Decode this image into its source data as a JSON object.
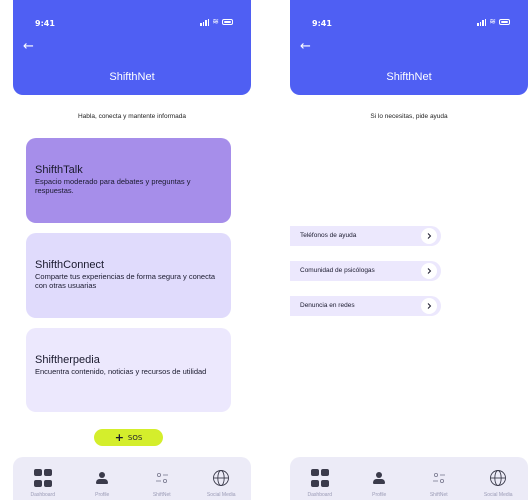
{
  "status_bar": {
    "time": "9:41"
  },
  "left_screen": {
    "header": {
      "back_arrow": "←",
      "title": "ShifthNet"
    },
    "subtitle": "Habla, conecta y mantente informada",
    "cards": [
      {
        "title": "ShifthTalk",
        "description": "Espacio moderado para debates y preguntas y respuestas.",
        "color": "#a68eea"
      },
      {
        "title": "ShifthConnect",
        "description": "Comparte tus experiencias de forma segura y conecta con otras usuarias",
        "color": "#e0dbfc"
      },
      {
        "title": "Shiftherpedia",
        "description": "Encuentra contenido, noticias y recursos de utilidad",
        "color": "#ece8fd"
      }
    ],
    "sos_button": {
      "label": "SOS",
      "icon": "plus-icon",
      "color": "#d4ee2c"
    }
  },
  "right_screen": {
    "header": {
      "back_arrow": "←",
      "title": "ShifthNet"
    },
    "subtitle": "Si lo necesitas, pide ayuda",
    "help_items": [
      {
        "label": "Teléfonos de ayuda",
        "icon": "chevron-right-icon"
      },
      {
        "label": "Comunidad de psicólogas",
        "icon": "chevron-right-icon"
      },
      {
        "label": "Denuncia en redes",
        "icon": "chevron-right-icon"
      }
    ]
  },
  "bottom_nav": [
    {
      "label": "Dashboard",
      "icon": "dashboard-grid-icon"
    },
    {
      "label": "Profile",
      "icon": "profile-icon"
    },
    {
      "label": "ShiftNet",
      "icon": "sliders-icon"
    },
    {
      "label": "Social Media",
      "icon": "globe-icon"
    }
  ],
  "colors": {
    "primary": "#4f5ff3",
    "nav_background": "#ecebf7",
    "accent": "#d4ee2c"
  }
}
